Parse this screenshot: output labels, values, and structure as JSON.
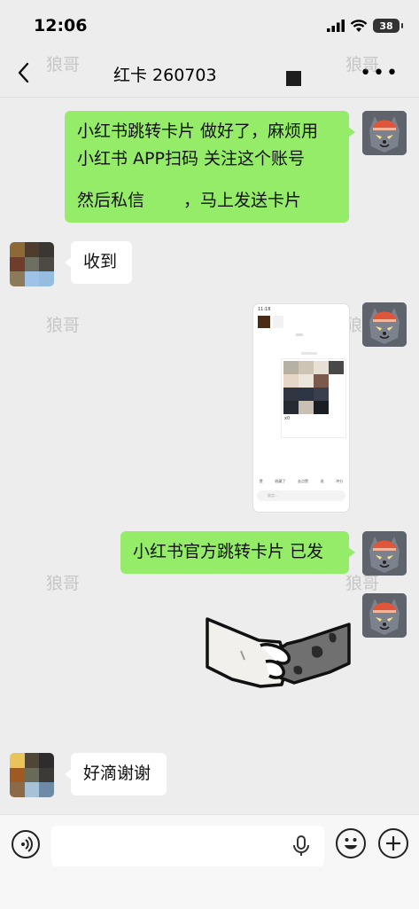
{
  "status_bar": {
    "time": "12:06",
    "battery": "38"
  },
  "nav": {
    "title": "红卡 260703",
    "more": "•••"
  },
  "watermark": "狼哥",
  "messages": [
    {
      "side": "right",
      "type": "text",
      "lines": [
        "小红书跳转卡片 做好了，麻烦用",
        "小红书 APP扫码 关注这个账号",
        "",
        "然后私信　　 ，马上发送卡片"
      ]
    },
    {
      "side": "left",
      "type": "text",
      "text": "收到"
    },
    {
      "side": "right",
      "type": "image"
    },
    {
      "side": "right",
      "type": "text",
      "text": "小红书官方跳转卡片 已发"
    },
    {
      "side": "right",
      "type": "sticker",
      "icon": "handshake-sticker"
    },
    {
      "side": "left",
      "type": "text",
      "text": "好滴谢谢"
    }
  ],
  "screenshot": {
    "time": "11:18",
    "tabs": [
      "赞",
      "收藏了",
      "去点赞",
      "说",
      "冲分"
    ],
    "likes": "x0",
    "input_placeholder": "说点..."
  },
  "colors": {
    "green_bubble": "#95ec69",
    "background": "#ededed"
  }
}
